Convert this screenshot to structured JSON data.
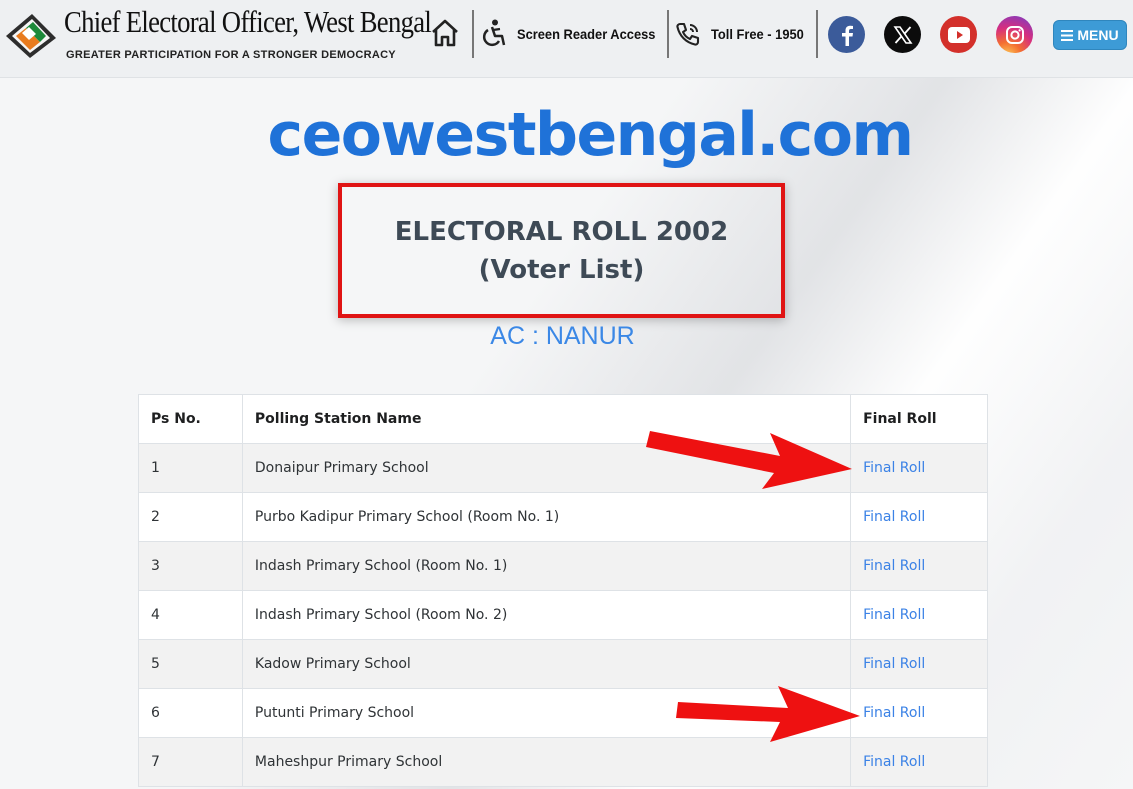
{
  "header": {
    "site_title": "Chief Electoral Officer, West Bengal",
    "tagline": "GREATER PARTICIPATION FOR A STRONGER DEMOCRACY",
    "home_icon": "home-icon",
    "accessibility_label": "Screen Reader Access",
    "toll_free_label": "Toll Free - 1950",
    "social": [
      "facebook-icon",
      "x-icon",
      "youtube-icon",
      "instagram-icon"
    ],
    "menu_label": "MENU"
  },
  "page": {
    "brand": "ceowestbengal.com",
    "title_line1": "ELECTORAL ROLL 2002",
    "title_line2": "(Voter List)",
    "ac_label": "AC : NANUR"
  },
  "table": {
    "headers": [
      "Ps No.",
      "Polling Station Name",
      "Final Roll"
    ],
    "rows": [
      {
        "ps": "1",
        "name": "Donaipur Primary School",
        "link": "Final Roll"
      },
      {
        "ps": "2",
        "name": "Purbo Kadipur Primary School (Room No. 1)",
        "link": "Final Roll"
      },
      {
        "ps": "3",
        "name": "Indash Primary School (Room No. 1)",
        "link": "Final Roll"
      },
      {
        "ps": "4",
        "name": "Indash Primary School (Room No. 2)",
        "link": "Final Roll"
      },
      {
        "ps": "5",
        "name": "Kadow Primary School",
        "link": "Final Roll"
      },
      {
        "ps": "6",
        "name": "Putunti Primary School",
        "link": "Final Roll"
      },
      {
        "ps": "7",
        "name": "Maheshpur Primary School",
        "link": "Final Roll"
      }
    ]
  },
  "colors": {
    "brand_blue": "#1f72d8",
    "link_blue": "#3b82e6",
    "highlight_red": "#e01414",
    "menu_blue": "#3d9bd6"
  }
}
